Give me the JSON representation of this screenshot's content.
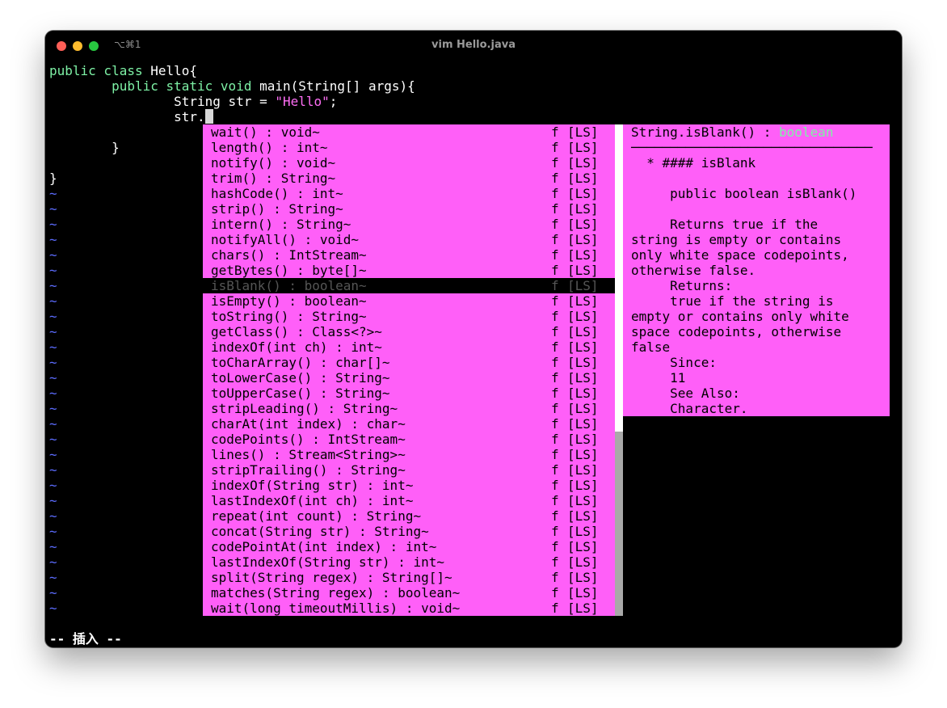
{
  "window": {
    "title": "vim Hello.java",
    "shortcut": "⌥⌘1"
  },
  "code": {
    "line1_kw": "public class",
    "line1_rest": " Hello{",
    "line2_kw": "public static void",
    "line2_rest": " main(String[] args){",
    "line3_a": "String str = ",
    "line3_str": "\"Hello\"",
    "line3_b": ";",
    "line4": "str.",
    "line5": "}",
    "line6": "}",
    "tilde": "~"
  },
  "completion": {
    "selected_index": 10,
    "items": [
      {
        "label": "wait() : void~",
        "kind": "f",
        "menu": "[LS]"
      },
      {
        "label": "length() : int~",
        "kind": "f",
        "menu": "[LS]"
      },
      {
        "label": "notify() : void~",
        "kind": "f",
        "menu": "[LS]"
      },
      {
        "label": "trim() : String~",
        "kind": "f",
        "menu": "[LS]"
      },
      {
        "label": "hashCode() : int~",
        "kind": "f",
        "menu": "[LS]"
      },
      {
        "label": "strip() : String~",
        "kind": "f",
        "menu": "[LS]"
      },
      {
        "label": "intern() : String~",
        "kind": "f",
        "menu": "[LS]"
      },
      {
        "label": "notifyAll() : void~",
        "kind": "f",
        "menu": "[LS]"
      },
      {
        "label": "chars() : IntStream~",
        "kind": "f",
        "menu": "[LS]"
      },
      {
        "label": "getBytes() : byte[]~",
        "kind": "f",
        "menu": "[LS]"
      },
      {
        "label": "isBlank() : boolean~",
        "kind": "f",
        "menu": "[LS]"
      },
      {
        "label": "isEmpty() : boolean~",
        "kind": "f",
        "menu": "[LS]"
      },
      {
        "label": "toString() : String~",
        "kind": "f",
        "menu": "[LS]"
      },
      {
        "label": "getClass() : Class<?>~",
        "kind": "f",
        "menu": "[LS]"
      },
      {
        "label": "indexOf(int ch) : int~",
        "kind": "f",
        "menu": "[LS]"
      },
      {
        "label": "toCharArray() : char[]~",
        "kind": "f",
        "menu": "[LS]"
      },
      {
        "label": "toLowerCase() : String~",
        "kind": "f",
        "menu": "[LS]"
      },
      {
        "label": "toUpperCase() : String~",
        "kind": "f",
        "menu": "[LS]"
      },
      {
        "label": "stripLeading() : String~",
        "kind": "f",
        "menu": "[LS]"
      },
      {
        "label": "charAt(int index) : char~",
        "kind": "f",
        "menu": "[LS]"
      },
      {
        "label": "codePoints() : IntStream~",
        "kind": "f",
        "menu": "[LS]"
      },
      {
        "label": "lines() : Stream<String>~",
        "kind": "f",
        "menu": "[LS]"
      },
      {
        "label": "stripTrailing() : String~",
        "kind": "f",
        "menu": "[LS]"
      },
      {
        "label": "indexOf(String str) : int~",
        "kind": "f",
        "menu": "[LS]"
      },
      {
        "label": "lastIndexOf(int ch) : int~",
        "kind": "f",
        "menu": "[LS]"
      },
      {
        "label": "repeat(int count) : String~",
        "kind": "f",
        "menu": "[LS]"
      },
      {
        "label": "concat(String str) : String~",
        "kind": "f",
        "menu": "[LS]"
      },
      {
        "label": "codePointAt(int index) : int~",
        "kind": "f",
        "menu": "[LS]"
      },
      {
        "label": "lastIndexOf(String str) : int~",
        "kind": "f",
        "menu": "[LS]"
      },
      {
        "label": "split(String regex) : String[]~",
        "kind": "f",
        "menu": "[LS]"
      },
      {
        "label": "matches(String regex) : boolean~",
        "kind": "f",
        "menu": "[LS]"
      },
      {
        "label": "wait(long timeoutMillis) : void~",
        "kind": "f",
        "menu": "[LS]"
      }
    ]
  },
  "doc": {
    "signature": "String.isBlank() : ",
    "return_type": "boolean",
    "separator": "───────────────────────────────",
    "lines": [
      "  * #### isBlank",
      "",
      "     public boolean isBlank()",
      "",
      "     Returns true if the",
      "string is empty or contains",
      "only white space codepoints,",
      "otherwise false.",
      "     Returns:",
      "     true if the string is",
      "empty or contains only white",
      "space codepoints, otherwise",
      "false",
      "     Since:",
      "     11",
      "     See Also:",
      "     Character."
    ]
  },
  "status": {
    "mode": "-- 插入 --"
  },
  "colors": {
    "keyword": "#7ef2a6",
    "string": "#ff6ef5",
    "popup_bg": "#ff5ff8",
    "tilde": "#5c6cff"
  }
}
